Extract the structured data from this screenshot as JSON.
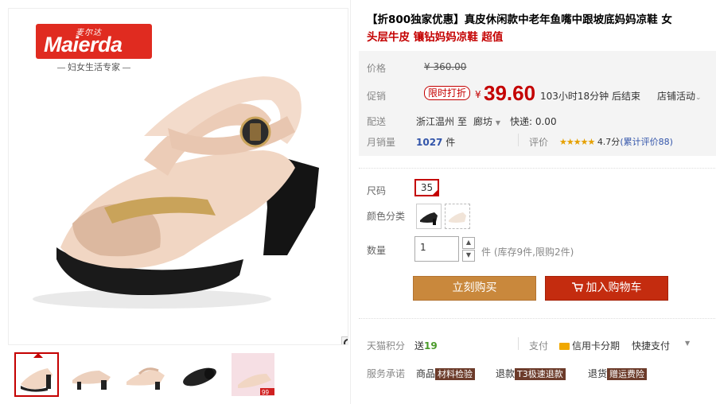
{
  "brand": {
    "logo_cn": "麦尔达",
    "logo_en": "Maierda",
    "tagline": "妇女生活专家"
  },
  "product": {
    "title_promo": "【折800独家优惠】",
    "title_rest": "真皮休闲款中老年鱼嘴中跟坡底妈妈凉鞋 女",
    "subtitle": "头层牛皮 镶钻妈妈凉鞋 超值"
  },
  "price": {
    "label": "价格",
    "original": "¥ 360.00",
    "promo_label": "促销",
    "badge": "限时打折",
    "yen": "¥",
    "current": "39.60",
    "countdown": "103小时18分钟 后结束",
    "store_promo": "店铺活动"
  },
  "shipping": {
    "label": "配送",
    "from": "浙江温州",
    "to_word": "至",
    "to": "廊坊",
    "fee": "快递: 0.00"
  },
  "sales": {
    "label": "月销量",
    "count": "1027",
    "unit": "件",
    "review_label": "评价",
    "stars": "★★★★★",
    "rating": "4.7分",
    "review_link": "(累计评价88)"
  },
  "options": {
    "size_label": "尺码",
    "size_value": "35",
    "color_label": "颜色分类"
  },
  "quantity": {
    "label": "数量",
    "value": "1",
    "stock": "件 (库存9件,限购2件)"
  },
  "actions": {
    "buy": "立刻购买",
    "cart": "加入购物车"
  },
  "footer": {
    "points_label": "天猫积分",
    "points_prefix": "送",
    "points_value": "19",
    "pay_label": "支付",
    "pay_card": "信用卡分期",
    "pay_quick": "快捷支付",
    "service_label": "服务承诺",
    "svc1_label": "商品",
    "svc1_tag": "材料检验",
    "svc2_label": "退款",
    "svc2_tag": "T3极速退款",
    "svc3_label": "退货",
    "svc3_tag": "赠运费险"
  }
}
